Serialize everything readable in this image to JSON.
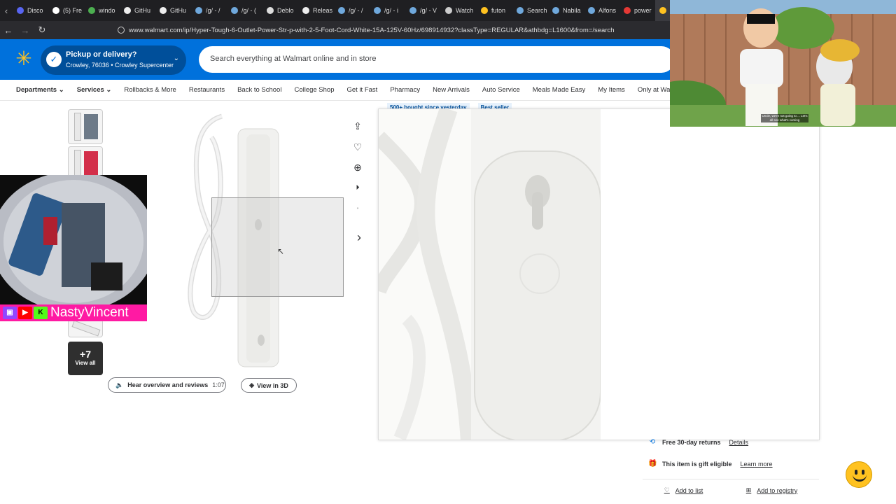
{
  "browser": {
    "tabs": [
      {
        "label": "Disco",
        "color": "#5865f2"
      },
      {
        "label": "(5) Fre",
        "color": "#ffffff"
      },
      {
        "label": "windo",
        "color": "#4caf50"
      },
      {
        "label": "GitHu",
        "color": "#eeeeee"
      },
      {
        "label": "GitHu",
        "color": "#eeeeee"
      },
      {
        "label": "/g/ - /",
        "color": "#6fa8dc"
      },
      {
        "label": "/g/ - (",
        "color": "#6fa8dc"
      },
      {
        "label": "Deblo",
        "color": "#dddddd"
      },
      {
        "label": "Releas",
        "color": "#eeeeee"
      },
      {
        "label": "/g/ - /",
        "color": "#6fa8dc"
      },
      {
        "label": "/g/ - i",
        "color": "#6fa8dc"
      },
      {
        "label": "/g/ - V",
        "color": "#6fa8dc"
      },
      {
        "label": "Watch",
        "color": "#cccccc"
      },
      {
        "label": "futon",
        "color": "#ffc220"
      },
      {
        "label": "Search",
        "color": "#6fa8dc"
      },
      {
        "label": "Nabila",
        "color": "#6fa8dc"
      },
      {
        "label": "Alfons",
        "color": "#6fa8dc"
      },
      {
        "label": "power",
        "color": "#e53935"
      }
    ],
    "url": "www.walmart.com/ip/Hyper-Tough-6-Outlet-Power-Str-p-with-2-5-Foot-Cord-White-15A-125V-60Hz/698914932?classType=REGULAR&athbdg=L1600&from=/search"
  },
  "header": {
    "pickup_title": "Pickup or delivery?",
    "pickup_sub": "Crowley, 76036 • Crowley Supercenter",
    "search_placeholder": "Search everything at Walmart online and in store",
    "brand_color": "#0071dc",
    "spark_color": "#ffc220"
  },
  "nav": {
    "items": [
      {
        "label": "Departments",
        "bold": true,
        "chevron": true
      },
      {
        "label": "Services",
        "bold": true,
        "chevron": true
      },
      {
        "label": "Rollbacks & More"
      },
      {
        "label": "Restaurants"
      },
      {
        "label": "Back to School"
      },
      {
        "label": "College Shop"
      },
      {
        "label": "Get it Fast"
      },
      {
        "label": "Pharmacy"
      },
      {
        "label": "New Arrivals"
      },
      {
        "label": "Auto Service"
      },
      {
        "label": "Meals Made Easy"
      },
      {
        "label": "My Items"
      },
      {
        "label": "Only at Wa"
      }
    ]
  },
  "product": {
    "view_all_count": "+7",
    "view_all_label": "View all",
    "hear_label": "Hear overview and reviews",
    "hear_duration": "1:07",
    "view3d_label": "View in 3D",
    "badges": [
      "500+ bought since yesterday",
      "Best seller"
    ]
  },
  "perks": {
    "returns": "Free 30-day returns",
    "returns_link": "Details",
    "gift": "This item is gift eligible",
    "gift_link": "Learn more",
    "add_list": "Add to list",
    "add_registry": "Add to registry"
  },
  "stream": {
    "streamer_name": "NastyVincent",
    "caption": "Uncle, we're not going to ... Let's all see what's coming"
  }
}
